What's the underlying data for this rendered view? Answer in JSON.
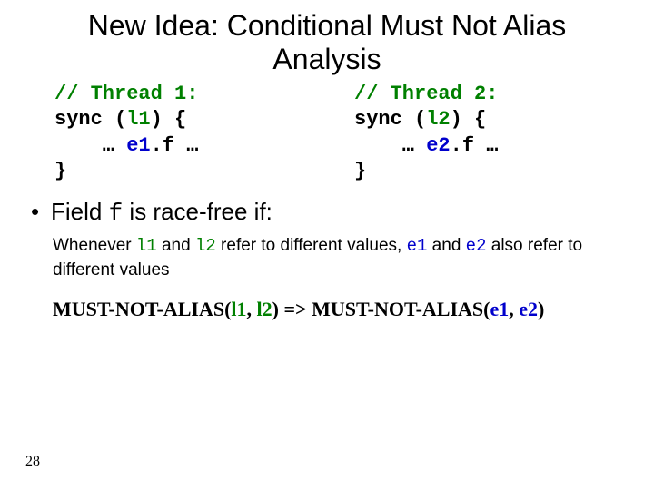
{
  "title": "New Idea: Conditional Must Not Alias Analysis",
  "code": {
    "t1": {
      "c": "// Thread 1:",
      "l1": "sync (",
      "l1v": "l1",
      "l1e": ") {",
      "l2a": "    … ",
      "l2v": "e1",
      "l2b": ".f …",
      "l3": "}"
    },
    "t2": {
      "c": "// Thread 2:",
      "l1": "sync (",
      "l1v": "l2",
      "l1e": ") {",
      "l2a": "    … ",
      "l2v": "e2",
      "l2b": ".f …",
      "l3": "}"
    }
  },
  "bullet": {
    "pre": "Field ",
    "f": "f",
    "post": " is race-free if:"
  },
  "sub": {
    "a": "Whenever ",
    "l1": "l1",
    "b": " and ",
    "l2": "l2",
    "c": " refer to different values, ",
    "e1": "e1",
    "d": " and ",
    "e2": "e2",
    "e": " also refer to different values"
  },
  "formula": {
    "a": "MUST-NOT-ALIAS(",
    "l1": "l1",
    "b": ", ",
    "l2": "l2",
    "c": ") => MUST-NOT-ALIAS(",
    "e1": "e1",
    "d": ", ",
    "e2": "e2",
    "e": ")"
  },
  "page": "28"
}
